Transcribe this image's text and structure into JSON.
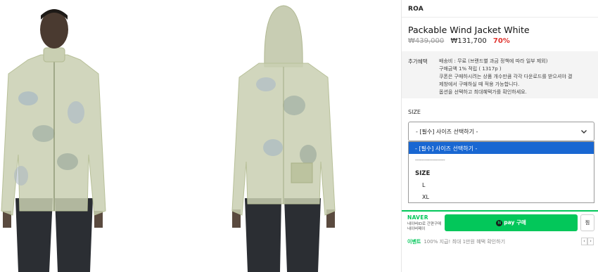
{
  "brand": "ROA",
  "product": {
    "title": "Packable Wind Jacket White",
    "original_price": "₩439,000",
    "sale_price": "₩131,700",
    "discount": "70%"
  },
  "benefits": {
    "label": "추가혜택",
    "lines": [
      "배송비 : 무료 (브랜드별 과금 정책에 따라 일부 제외)",
      "구매금액 1% 적립 ( 1317p )",
      "쿠폰은 구매하시려는 상품 개수만큼 각각 다운로드를 받으셔야 결",
      "제창에서 구매하실 때 적용 가능합니다.",
      "옵션을 선택하고 최대혜택가를 확인하세요."
    ]
  },
  "size": {
    "label": "SIZE",
    "select_value": "- [필수] 사이즈 선택하기 -",
    "options": {
      "selected": "- [필수] 사이즈 선택하기 -",
      "separator": "-------------------",
      "group": "SIZE",
      "items": [
        "L",
        "XL"
      ]
    }
  },
  "naver": {
    "logo": "NAVER",
    "sub1": "네이버ID로 간편구매",
    "sub2": "네이버페이",
    "pay_n": "N",
    "pay_label": "pay 구매",
    "wish_label": "찜"
  },
  "event": {
    "tag": "이벤트",
    "text": "100% 지급! 최대 1만원 혜택 확인하기",
    "prev": "‹",
    "next": "›"
  },
  "icons": [
    "chevron-down-icon",
    "naver-pay-n-icon",
    "arrow-left-icon",
    "arrow-right-icon"
  ],
  "colors": {
    "discount": "#e0342f",
    "naver_green": "#03c75a",
    "option_highlight": "#1967d2",
    "jacket_tint": "#c9cfb2"
  }
}
